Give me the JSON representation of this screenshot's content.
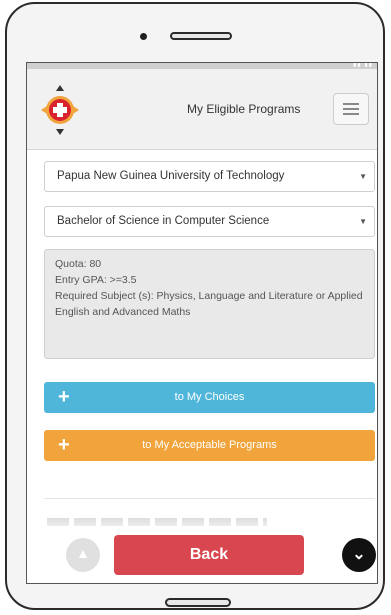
{
  "app": {
    "title": "My Eligible Programs"
  },
  "selects": {
    "university": "Papua New Guinea University of Technology",
    "program": "Bachelor of Science in Computer Science"
  },
  "info": {
    "quota": "Quota: 80",
    "gpa": "Entry GPA: >=3.5",
    "subjects": "Required Subject (s): Physics, Language and Literature or Applied English and Advanced Maths"
  },
  "buttons": {
    "add_choices_plus": "+",
    "add_choices": "to My Choices",
    "add_acceptable_plus": "+",
    "add_acceptable": "to My Acceptable Programs",
    "back": "Back"
  },
  "colors": {
    "choices_button": "#4fb6d9",
    "acceptable_button": "#f0a43b",
    "back_button": "#d8474f"
  },
  "icons": [
    "logo-icon",
    "hamburger-menu-icon",
    "dropdown-caret-icon",
    "plus-icon",
    "scroll-up-icon",
    "scroll-down-icon"
  ]
}
